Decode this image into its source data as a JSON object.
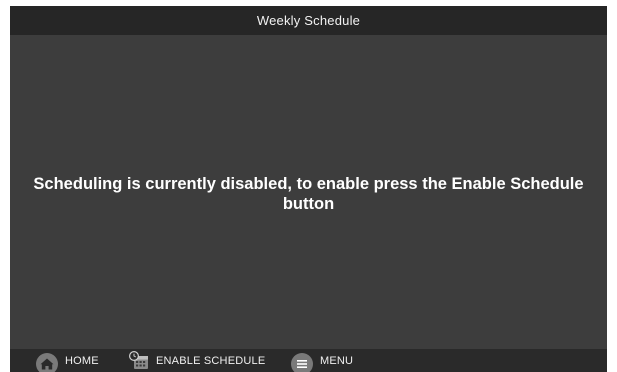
{
  "header": {
    "title": "Weekly Schedule"
  },
  "main": {
    "message": "Scheduling is currently disabled, to enable press the Enable Schedule button"
  },
  "nav": {
    "home_label": "HOME",
    "home_icon": "home-icon",
    "enable_label": "ENABLE SCHEDULE",
    "enable_icon": "calendar-clock-icon",
    "menu_label": "MENU",
    "menu_icon": "menu-icon"
  },
  "colors": {
    "background": "#3d3d3d",
    "title_bar": "#262626",
    "bottom_bar": "#2a2a2a",
    "icon_fill": "#7a7a7a",
    "text": "#ffffff"
  }
}
